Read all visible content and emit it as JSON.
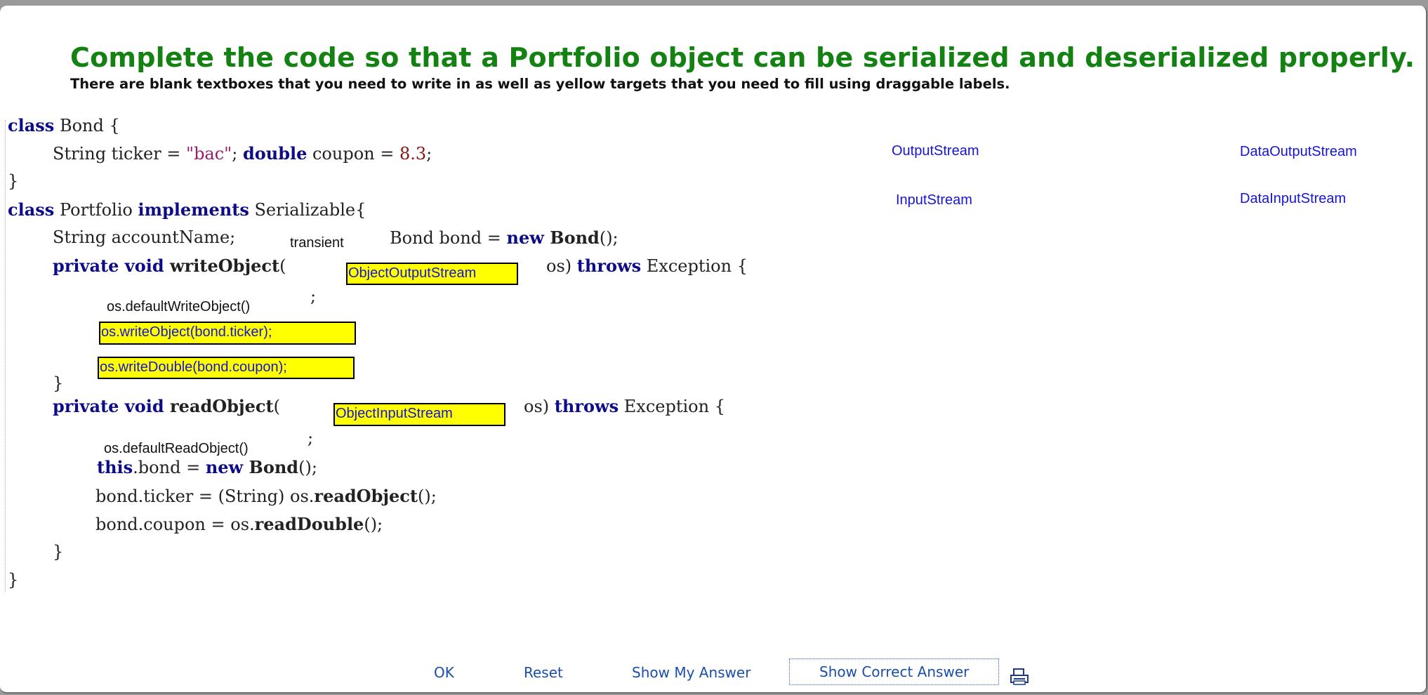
{
  "header": {
    "title": "Complete the code so that a Portfolio object can be serialized and deserialized properly.",
    "instructions": "There are blank textboxes that you need to write in as well as yellow targets that you need to fill using draggable labels."
  },
  "code": {
    "l1_kw": "class",
    "l1_rest": " Bond {",
    "l2_a": "String ticker = ",
    "l2_str": "\"bac\"",
    "l2_b": "; ",
    "l2_kw": "double",
    "l2_c": " coupon = ",
    "l2_num": "8.3",
    "l2_d": ";",
    "l3": "}",
    "l4_kw": "class",
    "l4_a": " Portfolio ",
    "l4_kw2": "implements",
    "l4_b": " Serializable{",
    "l5_a": "String accountName;",
    "l5_b": "Bond bond = ",
    "l5_kw": "new",
    "l5_bold": " Bond",
    "l5_c": "();",
    "l6_kw1": "private",
    "l6_kw2": " void",
    "l6_bold": " writeObject",
    "l6_a": "(",
    "l6_b": "os)",
    "l6_kw3": "throws",
    "l6_c": " Exception {",
    "l7_semi": ";",
    "l8": "}",
    "l9_kw1": "private",
    "l9_kw2": " void",
    "l9_bold": " readObject",
    "l9_a": "(",
    "l9_b": "os)",
    "l9_kw3": "throws",
    "l9_c": " Exception {",
    "l10_semi": ";",
    "l11_kw": "this",
    "l11_a": ".bond = ",
    "l11_kw2": "new",
    "l11_bold": " Bond",
    "l11_b": "();",
    "l12_a": "bond.ticker = (String) os.",
    "l12_bold": "readObject",
    "l12_b": "();",
    "l13_a": "bond.coupon = os.",
    "l13_bold": "readDouble",
    "l13_b": "();",
    "l14": "}",
    "l15": "}"
  },
  "fields": {
    "transient": "transient",
    "default_write": "os.defaultWriteObject()",
    "default_read": "os.defaultReadObject()"
  },
  "targets": {
    "write_param": "ObjectOutputStream",
    "write_ticker": "os.writeObject(bond.ticker);",
    "write_coupon": "os.writeDouble(bond.coupon);",
    "read_param": "ObjectInputStream"
  },
  "labels": {
    "output_stream": "OutputStream",
    "data_output_stream": "DataOutputStream",
    "input_stream": "InputStream",
    "data_input_stream": "DataInputStream"
  },
  "buttons": {
    "ok": "OK",
    "reset": "Reset",
    "show_my_answer": "Show My Answer",
    "show_correct_answer": "Show Correct Answer"
  },
  "icons": {
    "print": "printer-icon"
  },
  "colors": {
    "title": "#138213",
    "target": "#ffff00",
    "link": "#1515d8",
    "keyword": "#0c0c8a"
  }
}
